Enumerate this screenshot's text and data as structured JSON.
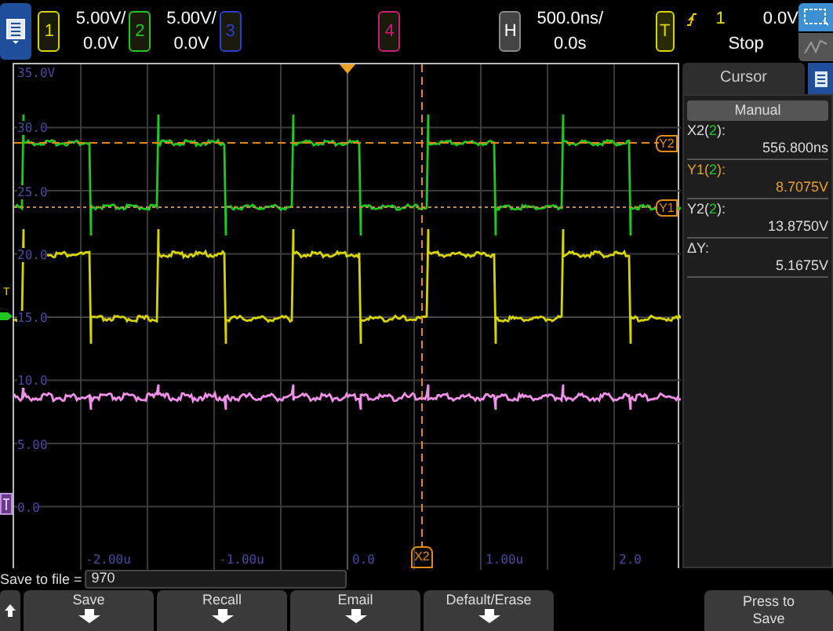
{
  "channels": [
    {
      "number": "1",
      "scale": "5.00V/",
      "offset": "0.0V",
      "color": "#d8d400"
    },
    {
      "number": "2",
      "scale": "5.00V/",
      "offset": "0.0V",
      "color": "#22c822"
    },
    {
      "number": "3",
      "color": "#2c3fcf"
    },
    {
      "number": "4",
      "color": "#c8207a"
    }
  ],
  "horizontal": {
    "badge": "H",
    "scale": "500.0ns/",
    "delay": "0.0s"
  },
  "trigger": {
    "badge": "T",
    "source": "1",
    "level": "0.0V",
    "status": "Stop"
  },
  "plot": {
    "y_labels": [
      "35.0V",
      "30.0",
      "25.0",
      "20.0",
      "15.0",
      "10.0",
      "5.00",
      "0.0"
    ],
    "x_labels": [
      "-2.00u",
      "-1.00u",
      "0.0",
      "1.00u",
      "2.0"
    ],
    "cursor_tags": {
      "x2": "X2",
      "y2": "Y2",
      "y1": "Y1"
    },
    "trigger_tag": "T"
  },
  "cursor_panel": {
    "title": "Cursor",
    "mode": "Manual",
    "readouts": [
      {
        "label_parts": [
          "X2(",
          "2",
          "):"
        ],
        "value": "556.800ns",
        "highlighted": false
      },
      {
        "label_parts": [
          "Y1(",
          "2",
          "):"
        ],
        "value": "8.7075V",
        "highlighted": true
      },
      {
        "label_parts": [
          "Y2(",
          "2",
          "):"
        ],
        "value": "13.8750V",
        "highlighted": false
      },
      {
        "label_parts": [
          "ΔY:"
        ],
        "value": "5.1675V",
        "highlighted": false
      }
    ]
  },
  "save_to_file": {
    "label": "Save to file =",
    "value": "970"
  },
  "softkeys": [
    {
      "label": "Save"
    },
    {
      "label": "Recall"
    },
    {
      "label": "Email"
    },
    {
      "label": "Default/Erase"
    }
  ],
  "press_key": {
    "lines": [
      "Press to",
      "Save"
    ]
  }
}
